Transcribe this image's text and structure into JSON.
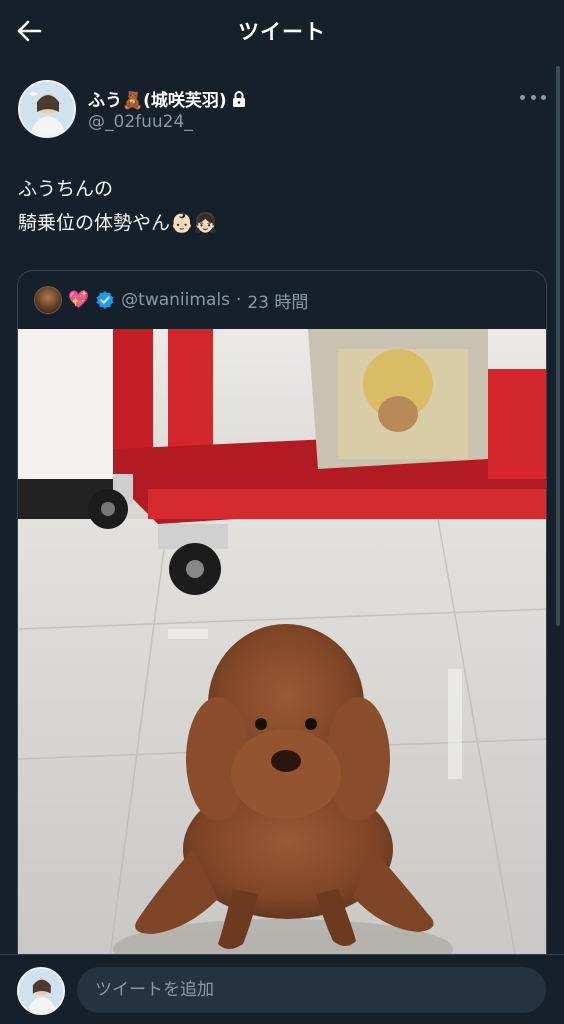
{
  "header": {
    "title": "ツイート",
    "back_icon": "arrow-left-icon"
  },
  "author": {
    "display_name": "ふう🧸(城咲芙羽)",
    "handle": "@_02fuu24_",
    "protected_icon": "lock-icon"
  },
  "tweet": {
    "line1": "ふうちんの",
    "line2": "騎乗位の体勢やん👶🏻👧🏻"
  },
  "quote": {
    "badge_emoji": "💖",
    "handle": "@twaniimals",
    "separator": "·",
    "time": "23 時間"
  },
  "reply": {
    "placeholder": "ツイートを追加"
  },
  "colors": {
    "background": "#15202b",
    "border": "#38444d",
    "muted": "#8b98a5",
    "verified": "#1d9bf0"
  }
}
